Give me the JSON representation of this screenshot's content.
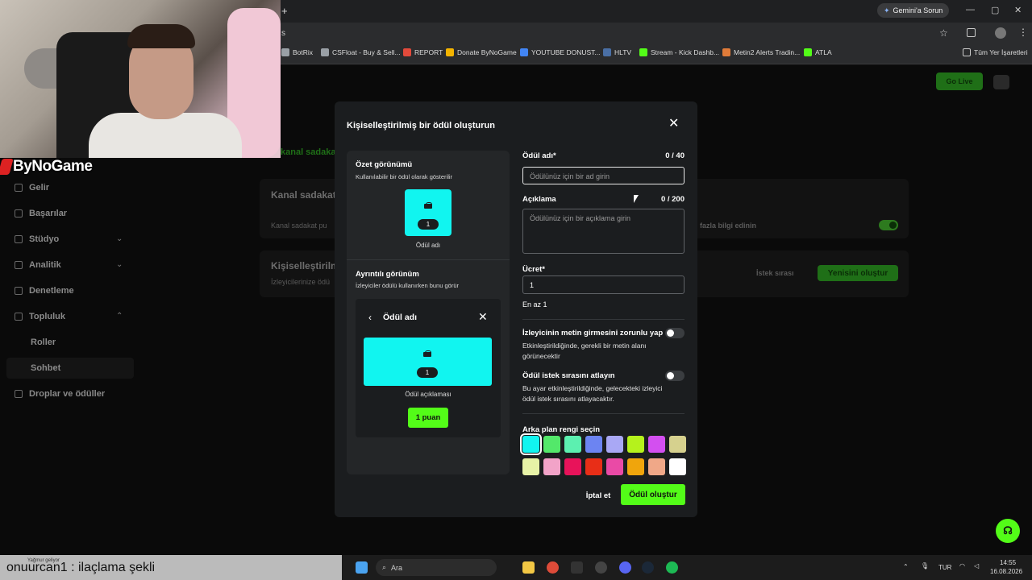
{
  "browser": {
    "gemini_label": "Gemini'a Sorun",
    "new_tab": "+",
    "address_fragment": "s",
    "bookmarks": [
      {
        "label": "BotRix",
        "color": "#9aa0a6"
      },
      {
        "label": "CSFloat - Buy & Sell...",
        "color": "#9aa0a6"
      },
      {
        "label": "REPORT",
        "color": "#e24a3b"
      },
      {
        "label": "Donate ByNoGame",
        "color": "#f4b400"
      },
      {
        "label": "YOUTUBE DONUST...",
        "color": "#4285f4"
      },
      {
        "label": "HLTV",
        "color": "#4a6fa5"
      },
      {
        "label": "Stream - Kick Dashb...",
        "color": "#53fc18"
      },
      {
        "label": "Metin2 Alerts Tradin...",
        "color": "#e07b39"
      },
      {
        "label": "ATLA",
        "color": "#53fc18"
      }
    ],
    "all_bookmarks": "Tüm Yer İşaretleri"
  },
  "streamer": {
    "brand": "ByNoGame"
  },
  "dashboard": {
    "go_live": "Go Live",
    "sidebar": [
      {
        "label": "Gelir",
        "sub": false
      },
      {
        "label": "Başarılar",
        "sub": false
      },
      {
        "label": "Stüdyo",
        "sub": false
      },
      {
        "label": "Analitik",
        "sub": false
      },
      {
        "label": "Denetleme",
        "sub": false
      },
      {
        "label": "Topluluk",
        "sub": false
      },
      {
        "label": "Roller",
        "sub": true
      },
      {
        "label": "Sohbet",
        "sub": true
      },
      {
        "label": "Droplar ve ödüller",
        "sub": false
      }
    ],
    "loyalty_tab": "kanal sadakat p",
    "loyalty_title": "Kanal sadakat",
    "loyalty_row": "Kanal sadakat pu",
    "learn_more": "fazla bilgi edinin",
    "custom_title": "Kişiselleştirilm",
    "custom_sub": "İzleyicilerinize ödü",
    "queue": "İstek sırası",
    "create_new": "Yenisini oluştur"
  },
  "modal": {
    "title": "Kişiselleştirilmiş bir ödül oluşturun",
    "summary_heading": "Özet görünümü",
    "summary_sub": "Kullanılabilir bir ödül olarak gösterilir",
    "badge_value": "1",
    "summary_label": "Ödül adı",
    "detail_heading": "Ayrıntılı görünüm",
    "detail_sub": "İzleyiciler ödülü kullanırken bunu görür",
    "detail_title": "Ödül adı",
    "detail_desc": "Ödül açıklaması",
    "points_btn": "1 puan",
    "name_label": "Ödül adı*",
    "name_count": "0 / 40",
    "name_placeholder": "Ödülünüz için bir ad girin",
    "desc_label": "Açıklama",
    "desc_count": "0 / 200",
    "desc_placeholder": "Ödülünüz için bir açıklama girin",
    "price_label": "Ücret*",
    "price_value": "1",
    "price_min": "En az 1",
    "toggle1_title": "İzleyicinin metin girmesini zorunlu yap",
    "toggle1_desc": "Etkinleştirildiğinde, gerekli bir metin alanı görünecektir",
    "toggle2_title": "Ödül istek sırasını atlayın",
    "toggle2_desc": "Bu ayar etkinleştirildiğinde, gelecekteki izleyici ödül istek sırasını atlayacaktır.",
    "color_label": "Arka plan rengi seçin",
    "colors": [
      "#11f5f0",
      "#53e86a",
      "#5cf0b0",
      "#6c84f2",
      "#a9a8f5",
      "#b5f21c",
      "#d34ff0",
      "#d6d18e",
      "#e7f2a6",
      "#f2a3c8",
      "#e8135a",
      "#e82e17",
      "#ea4aa6",
      "#f0a50c",
      "#f0a888",
      "#ffffff"
    ],
    "selected_color": "#11f5f0",
    "cancel": "İptal et",
    "create": "Ödül oluştur"
  },
  "chat": {
    "caption": "onuurcan1 : ilaçlama şekli",
    "small": "Yağmur geliyor"
  },
  "taskbar": {
    "search": "Ara",
    "lang": "TUR",
    "time": "14:55",
    "date": "16.08.2026"
  }
}
